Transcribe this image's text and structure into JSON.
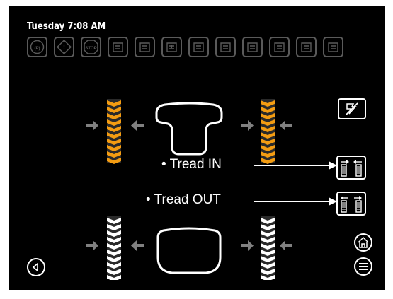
{
  "status": {
    "datetime": "Tuesday 7:08 AM"
  },
  "warning_icons": [
    {
      "name": "parking-brake-icon",
      "text": "(P)"
    },
    {
      "name": "master-warning-icon",
      "text": "!"
    },
    {
      "name": "stop-icon",
      "text": "STOP"
    },
    {
      "name": "fuel-filter-icon",
      "text": ""
    },
    {
      "name": "coolant-temp-icon",
      "text": ""
    },
    {
      "name": "transmission-warning-icon",
      "text": "!"
    },
    {
      "name": "transmission-filter-icon",
      "text": ""
    },
    {
      "name": "transmission-temp-icon",
      "text": ""
    },
    {
      "name": "hydraulic-temp-icon",
      "text": ""
    },
    {
      "name": "hydraulic-filter-icon",
      "text": ""
    },
    {
      "name": "engine-oil-icon",
      "text": ""
    },
    {
      "name": "air-filter-icon",
      "text": ""
    }
  ],
  "callouts": {
    "tread_in": "• Tread IN",
    "tread_out": "• Tread OUT"
  },
  "colors": {
    "active_tread": "#f39c12",
    "inactive_tread": "#ffffff",
    "icon_dim": "#5a5a5a"
  }
}
